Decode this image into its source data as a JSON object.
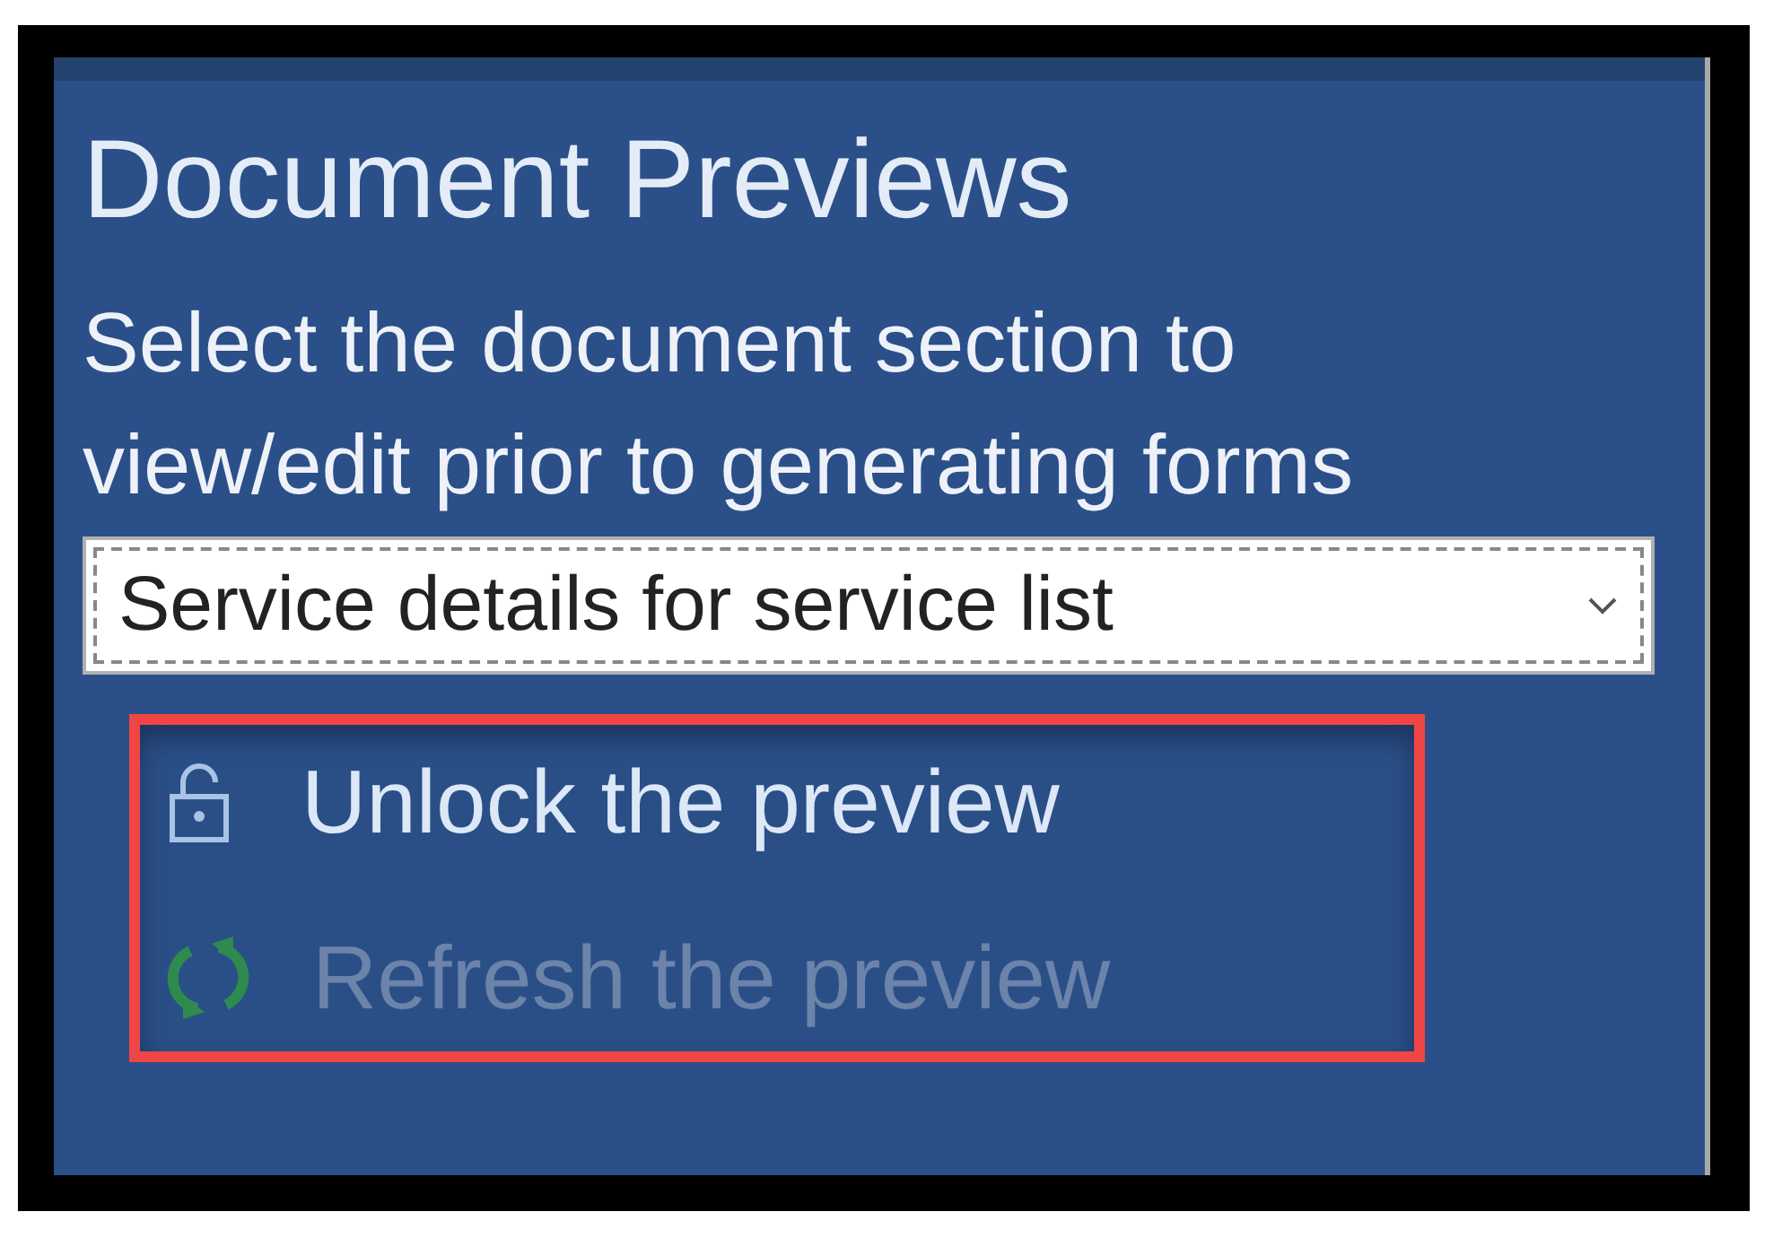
{
  "panel": {
    "title": "Document Previews",
    "description": "Select the document section to view/edit prior to generating forms",
    "section_dropdown": {
      "value": "Service details for service list"
    },
    "actions": {
      "highlighted": true,
      "items": [
        {
          "kind": "unlock",
          "label": "Unlock the preview",
          "disabled": false
        },
        {
          "kind": "refresh",
          "label": "Refresh the preview",
          "disabled": true
        }
      ]
    }
  }
}
